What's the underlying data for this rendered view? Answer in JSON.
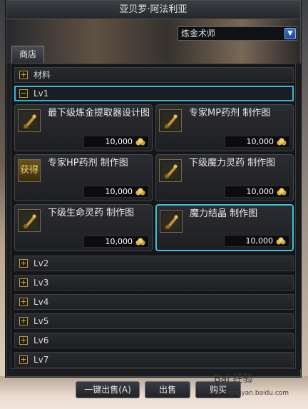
{
  "window": {
    "title": "亚贝罗·阿法利亚"
  },
  "class_select": {
    "value": "炼金术师"
  },
  "tab": {
    "shop": "商店"
  },
  "categories": [
    {
      "label": "材料",
      "expanded": false
    },
    {
      "label": "Lv1",
      "expanded": true
    },
    {
      "label": "Lv2",
      "expanded": false
    },
    {
      "label": "Lv3",
      "expanded": false
    },
    {
      "label": "Lv4",
      "expanded": false
    },
    {
      "label": "Lv5",
      "expanded": false
    },
    {
      "label": "Lv6",
      "expanded": false
    },
    {
      "label": "Lv7",
      "expanded": false
    }
  ],
  "items": [
    {
      "name": "最下级炼金提取器设计图",
      "price": "10,000",
      "icon": "scroll-icon"
    },
    {
      "name": "专家MP药剂 制作图",
      "price": "10,000",
      "icon": "scroll-icon"
    },
    {
      "name": "专家HP药剂 制作图",
      "price": "10,000",
      "icon": "obtained-icon",
      "icon_text": "获得"
    },
    {
      "name": "下级魔力灵药 制作图",
      "price": "10,000",
      "icon": "scroll-icon"
    },
    {
      "name": "下级生命灵药 制作图",
      "price": "10,000",
      "icon": "scroll-icon"
    },
    {
      "name": "魔力结晶 制作图",
      "price": "10,000",
      "icon": "scroll-icon",
      "selected": true
    }
  ],
  "buttons": {
    "sell_all": "一键出售(A)",
    "sell": "出售",
    "buy": "购买"
  },
  "watermark": {
    "brand": "Bai 经验",
    "url": "jingyan.baidu.com"
  },
  "colors": {
    "accent": "#36b6cc",
    "gold": "#d8b84d"
  }
}
